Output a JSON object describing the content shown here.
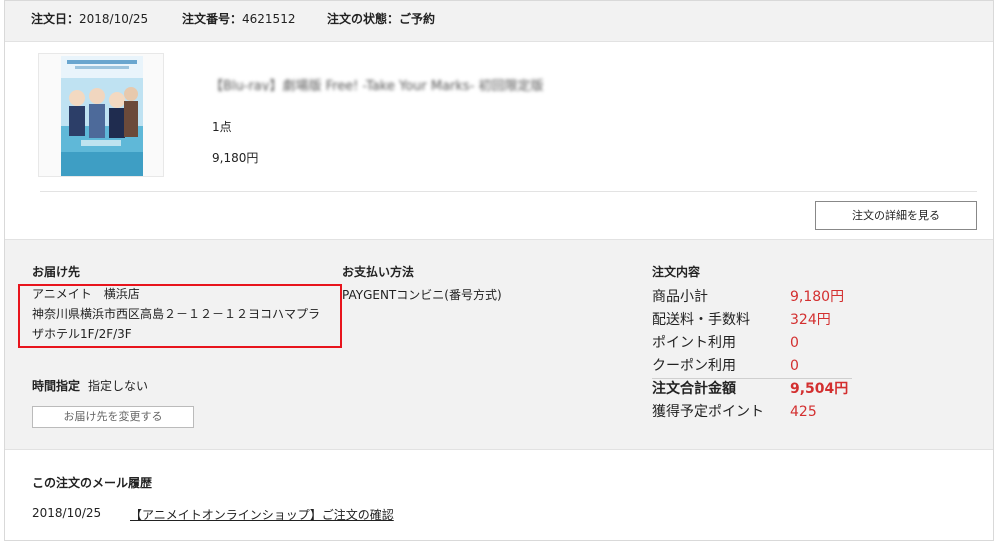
{
  "header": {
    "order_date_label": "注文日：",
    "order_date": "2018/10/25",
    "order_no_label": "注文番号：",
    "order_no": "4621512",
    "status_label": "注文の状態：",
    "status": "ご予約"
  },
  "product": {
    "title": "【Blu-ray】劇場版 Free! -Take Your Marks- 初回限定版",
    "qty": "1点",
    "price": "9,180円"
  },
  "detail_button": "注文の詳細を見る",
  "delivery": {
    "heading": "お届け先",
    "line1": "アニメイト　横浜店",
    "line2": "神奈川県横浜市西区高島２－１２－１２ヨコハマプラ",
    "line3": "ザホテル1F/2F/3F",
    "time_label": "時間指定",
    "time_value": "指定しない",
    "change_button": "お届け先を変更する"
  },
  "payment": {
    "heading": "お支払い方法",
    "method": "PAYGENTコンビニ(番号方式)"
  },
  "summary": {
    "heading": "注文内容",
    "rows": [
      {
        "label": "商品小計",
        "value": "9,180円"
      },
      {
        "label": "配送料・手数料",
        "value": "324円"
      },
      {
        "label": "ポイント利用",
        "value": "0"
      },
      {
        "label": "クーポン利用",
        "value": "0"
      }
    ],
    "total_label": "注文合計金額",
    "total_value": "9,504円",
    "points_label": "獲得予定ポイント",
    "points_value": "425"
  },
  "mail_history": {
    "heading": "この注文のメール履歴",
    "date": "2018/10/25",
    "subject": "【アニメイトオンラインショップ】ご注文の確認"
  },
  "colors": {
    "accent_red": "#d32f2f",
    "highlight_box": "#e8141d",
    "header_bg": "#f2f2f2"
  }
}
